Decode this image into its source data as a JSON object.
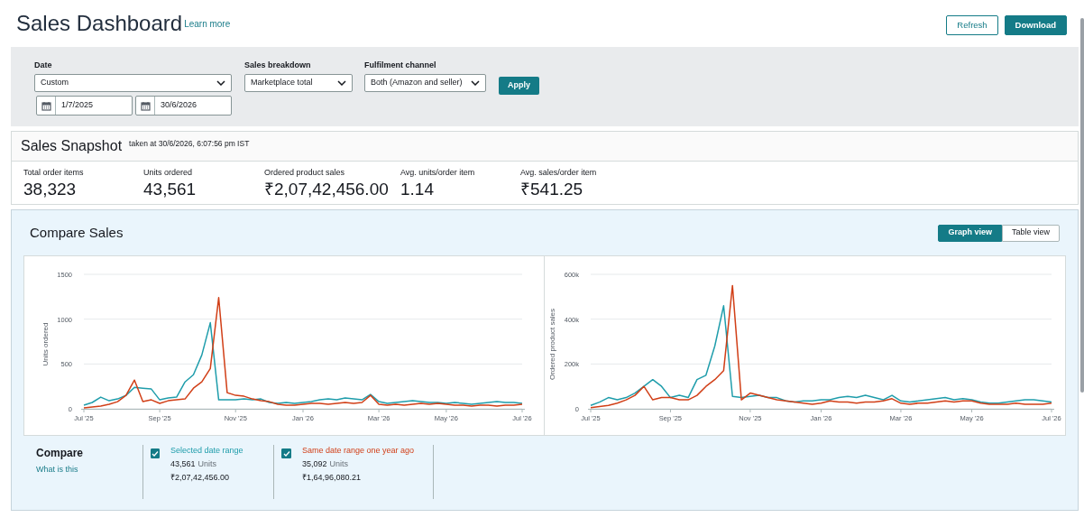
{
  "header": {
    "title": "Sales Dashboard",
    "learn_more": "Learn more",
    "buttons": [
      {
        "label": "Refresh",
        "kind": "secondary"
      },
      {
        "label": "Download",
        "kind": "primary"
      }
    ]
  },
  "filters": {
    "date": {
      "label": "Date",
      "value": "Custom",
      "start": "1/7/2025",
      "end": "30/6/2026"
    },
    "sales_breakdown": {
      "label": "Sales breakdown",
      "value": "Marketplace total"
    },
    "fulfilment_channel": {
      "label": "Fulfilment channel",
      "value": "Both (Amazon and seller)"
    },
    "apply": "Apply"
  },
  "snapshot": {
    "title": "Sales Snapshot",
    "taken_at": "taken at 30/6/2026, 6:07:56 pm IST",
    "metrics": [
      {
        "label": "Total order items",
        "value": "38,323"
      },
      {
        "label": "Units ordered",
        "value": "43,561"
      },
      {
        "label": "Ordered product sales",
        "value": "₹2,07,42,456.00"
      },
      {
        "label": "Avg. units/order item",
        "value": "1.14"
      },
      {
        "label": "Avg. sales/order item",
        "value": "₹541.25"
      }
    ]
  },
  "compare_sales": {
    "title": "Compare Sales",
    "views": [
      {
        "label": "Graph view",
        "selected": true
      },
      {
        "label": "Table view",
        "selected": false
      }
    ],
    "charts": [
      {
        "chart_data": {
          "type": "line",
          "ylabel": "Units ordered",
          "ylim": [
            0,
            1500
          ],
          "yticks": [
            0,
            500,
            1000,
            1500
          ],
          "categories": [
            "Jul '25",
            null,
            null,
            null,
            null,
            null,
            null,
            null,
            null,
            "Sep '25",
            null,
            null,
            null,
            null,
            null,
            null,
            null,
            null,
            "Nov '25",
            null,
            null,
            null,
            null,
            null,
            null,
            null,
            "Jan '26",
            null,
            null,
            null,
            null,
            null,
            null,
            null,
            null,
            "Mar '26",
            null,
            null,
            null,
            null,
            null,
            null,
            null,
            "May '26",
            null,
            null,
            null,
            null,
            null,
            null,
            null,
            null,
            "Jul '26"
          ],
          "series": [
            {
              "color": "#1f9dab",
              "values": [
                40,
                70,
                130,
                90,
                110,
                150,
                240,
                230,
                220,
                100,
                120,
                130,
                300,
                380,
                600,
                960,
                100,
                100,
                100,
                110,
                100,
                110,
                70,
                60,
                70,
                60,
                70,
                80,
                100,
                110,
                100,
                120,
                110,
                100,
                160,
                80,
                60,
                70,
                80,
                90,
                80,
                70,
                70,
                60,
                70,
                60,
                50,
                60,
                70,
                80,
                70,
                70,
                60
              ]
            },
            {
              "color": "#d13f17",
              "values": [
                10,
                20,
                30,
                50,
                80,
                150,
                320,
                80,
                100,
                60,
                90,
                100,
                110,
                230,
                300,
                450,
                1240,
                180,
                150,
                140,
                110,
                90,
                80,
                50,
                40,
                40,
                50,
                60,
                60,
                50,
                60,
                70,
                60,
                70,
                150,
                50,
                40,
                50,
                40,
                50,
                60,
                50,
                60,
                50,
                40,
                40,
                30,
                40,
                40,
                30,
                40,
                40,
                50
              ]
            }
          ]
        }
      },
      {
        "chart_data": {
          "type": "line",
          "ylabel": "Ordered product sales",
          "ylim": [
            0,
            600000
          ],
          "yticks": [
            {
              "value": 0,
              "label": "0"
            },
            {
              "value": 200000,
              "label": "200k"
            },
            {
              "value": 400000,
              "label": "400k"
            },
            {
              "value": 600000,
              "label": "600k"
            }
          ],
          "categories": [
            "Jul '25",
            null,
            null,
            null,
            null,
            null,
            null,
            null,
            null,
            "Sep '25",
            null,
            null,
            null,
            null,
            null,
            null,
            null,
            null,
            "Nov '25",
            null,
            null,
            null,
            null,
            null,
            null,
            null,
            "Jan '26",
            null,
            null,
            null,
            null,
            null,
            null,
            null,
            null,
            "Mar '26",
            null,
            null,
            null,
            null,
            null,
            null,
            null,
            "May '26",
            null,
            null,
            null,
            null,
            null,
            null,
            null,
            null,
            "Jul '26"
          ],
          "series": [
            {
              "color": "#1f9dab",
              "values": [
                15000,
                30000,
                50000,
                40000,
                50000,
                70000,
                100000,
                130000,
                100000,
                50000,
                60000,
                50000,
                130000,
                150000,
                280000,
                460000,
                55000,
                50000,
                55000,
                60000,
                50000,
                50000,
                35000,
                30000,
                35000,
                35000,
                40000,
                40000,
                50000,
                55000,
                50000,
                60000,
                50000,
                40000,
                60000,
                35000,
                30000,
                35000,
                40000,
                45000,
                50000,
                40000,
                45000,
                40000,
                30000,
                25000,
                25000,
                30000,
                35000,
                40000,
                40000,
                35000,
                30000
              ]
            },
            {
              "color": "#d13f17",
              "values": [
                5000,
                10000,
                15000,
                25000,
                40000,
                60000,
                100000,
                40000,
                50000,
                50000,
                40000,
                40000,
                60000,
                100000,
                130000,
                170000,
                550000,
                40000,
                70000,
                60000,
                50000,
                40000,
                35000,
                30000,
                25000,
                20000,
                25000,
                35000,
                30000,
                30000,
                25000,
                30000,
                30000,
                35000,
                45000,
                25000,
                20000,
                25000,
                25000,
                30000,
                35000,
                30000,
                35000,
                35000,
                25000,
                20000,
                20000,
                20000,
                25000,
                20000,
                20000,
                20000,
                25000
              ]
            }
          ]
        }
      }
    ],
    "compare": {
      "title": "Compare",
      "help_link": "What is this",
      "items": [
        {
          "label": "Selected date range",
          "checked": true,
          "units": "43,561",
          "units_label": "Units",
          "sales": "₹2,07,42,456.00"
        },
        {
          "label": "Same date range one year ago",
          "checked": true,
          "units": "35,092",
          "units_label": "Units",
          "sales": "₹1,64,96,080.21"
        }
      ]
    }
  }
}
